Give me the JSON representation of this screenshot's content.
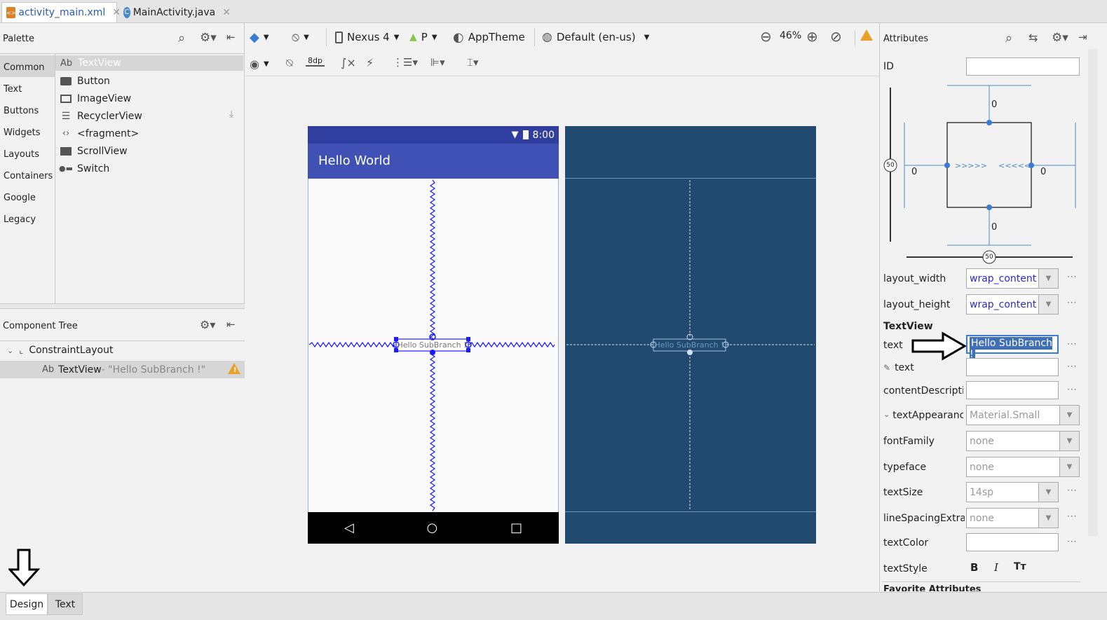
{
  "editor_tabs": [
    {
      "label": "activity_main.xml",
      "icon": "xml-file-icon",
      "active": true
    },
    {
      "label": "MainActivity.java",
      "icon": "java-class-icon",
      "active": false
    }
  ],
  "palette": {
    "title": "Palette",
    "categories": [
      "Common",
      "Text",
      "Buttons",
      "Widgets",
      "Layouts",
      "Containers",
      "Google",
      "Legacy"
    ],
    "selected_category": "Common",
    "items": [
      {
        "label": "TextView",
        "icon": "textview-icon",
        "selected": true
      },
      {
        "label": "Button",
        "icon": "button-icon"
      },
      {
        "label": "ImageView",
        "icon": "imageview-icon"
      },
      {
        "label": "RecyclerView",
        "icon": "recyclerview-icon"
      },
      {
        "label": "<fragment>",
        "icon": "fragment-icon"
      },
      {
        "label": "ScrollView",
        "icon": "scrollview-icon"
      },
      {
        "label": "Switch",
        "icon": "switch-icon"
      }
    ],
    "textview_prefix": "Ab"
  },
  "component_tree": {
    "title": "Component Tree",
    "root": "ConstraintLayout",
    "child_prefix": "Ab",
    "child": "TextView",
    "child_text": " - \"Hello SubBranch !\""
  },
  "toolbar": {
    "device": "Nexus 4",
    "api": "P",
    "theme": "AppTheme",
    "locale": "Default (en-us)",
    "zoom": "46%",
    "margin": "8dp"
  },
  "phone": {
    "time": "8:00",
    "app_title": "Hello World",
    "textview": "Hello SubBranch !"
  },
  "attributes": {
    "title": "Attributes",
    "id_label": "ID",
    "constraint": {
      "top": "0",
      "bottom": "0",
      "left": "0",
      "right": "0",
      "vbias": "50",
      "hbias": "50"
    },
    "layout_width_label": "layout_width",
    "layout_width": "wrap_content",
    "layout_height_label": "layout_height",
    "layout_height": "wrap_content",
    "section": "TextView",
    "text_label": "text",
    "text_value": "Hello SubBranch !",
    "text2_label": "text",
    "content_desc_label": "contentDescriptic",
    "text_appearance_label": "textAppearanc",
    "text_appearance": "Material.Small",
    "font_family_label": "fontFamily",
    "font_family": "none",
    "typeface_label": "typeface",
    "typeface": "none",
    "text_size_label": "textSize",
    "text_size": "14sp",
    "line_spacing_label": "lineSpacingExtra",
    "line_spacing": "none",
    "text_color_label": "textColor",
    "text_style_label": "textStyle",
    "style_bold": "B",
    "style_italic": "I",
    "style_caps": "Tт",
    "favorite": "Favorite Attributes"
  },
  "bottom_tabs": {
    "design": "Design",
    "text": "Text"
  },
  "colors": {
    "primary": "#3F51B5",
    "primary_dark": "#303F9F",
    "blueprint": "#214A6E",
    "selection": "#1a1aff"
  }
}
